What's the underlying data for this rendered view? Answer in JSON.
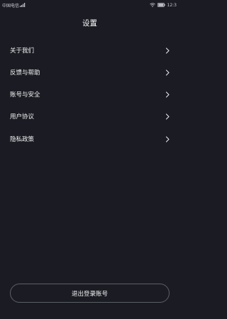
{
  "status_bar": {
    "carrier": "中国电信",
    "time": "12:3"
  },
  "header": {
    "title": "设置"
  },
  "menu": {
    "items": [
      {
        "label": "关于我们"
      },
      {
        "label": "反馈与帮助"
      },
      {
        "label": "账号与安全"
      },
      {
        "label": "用户协议"
      },
      {
        "label": "隐私政策"
      }
    ]
  },
  "footer": {
    "logout_label": "退出登录账号"
  },
  "icons": {
    "chevron": "chevron-right-icon",
    "wifi": "wifi-icon",
    "signal": "signal-icon",
    "battery": "battery-icon"
  },
  "colors": {
    "background": "#1b1c23",
    "text": "#f2f2f4",
    "border": "#5d5f68"
  }
}
